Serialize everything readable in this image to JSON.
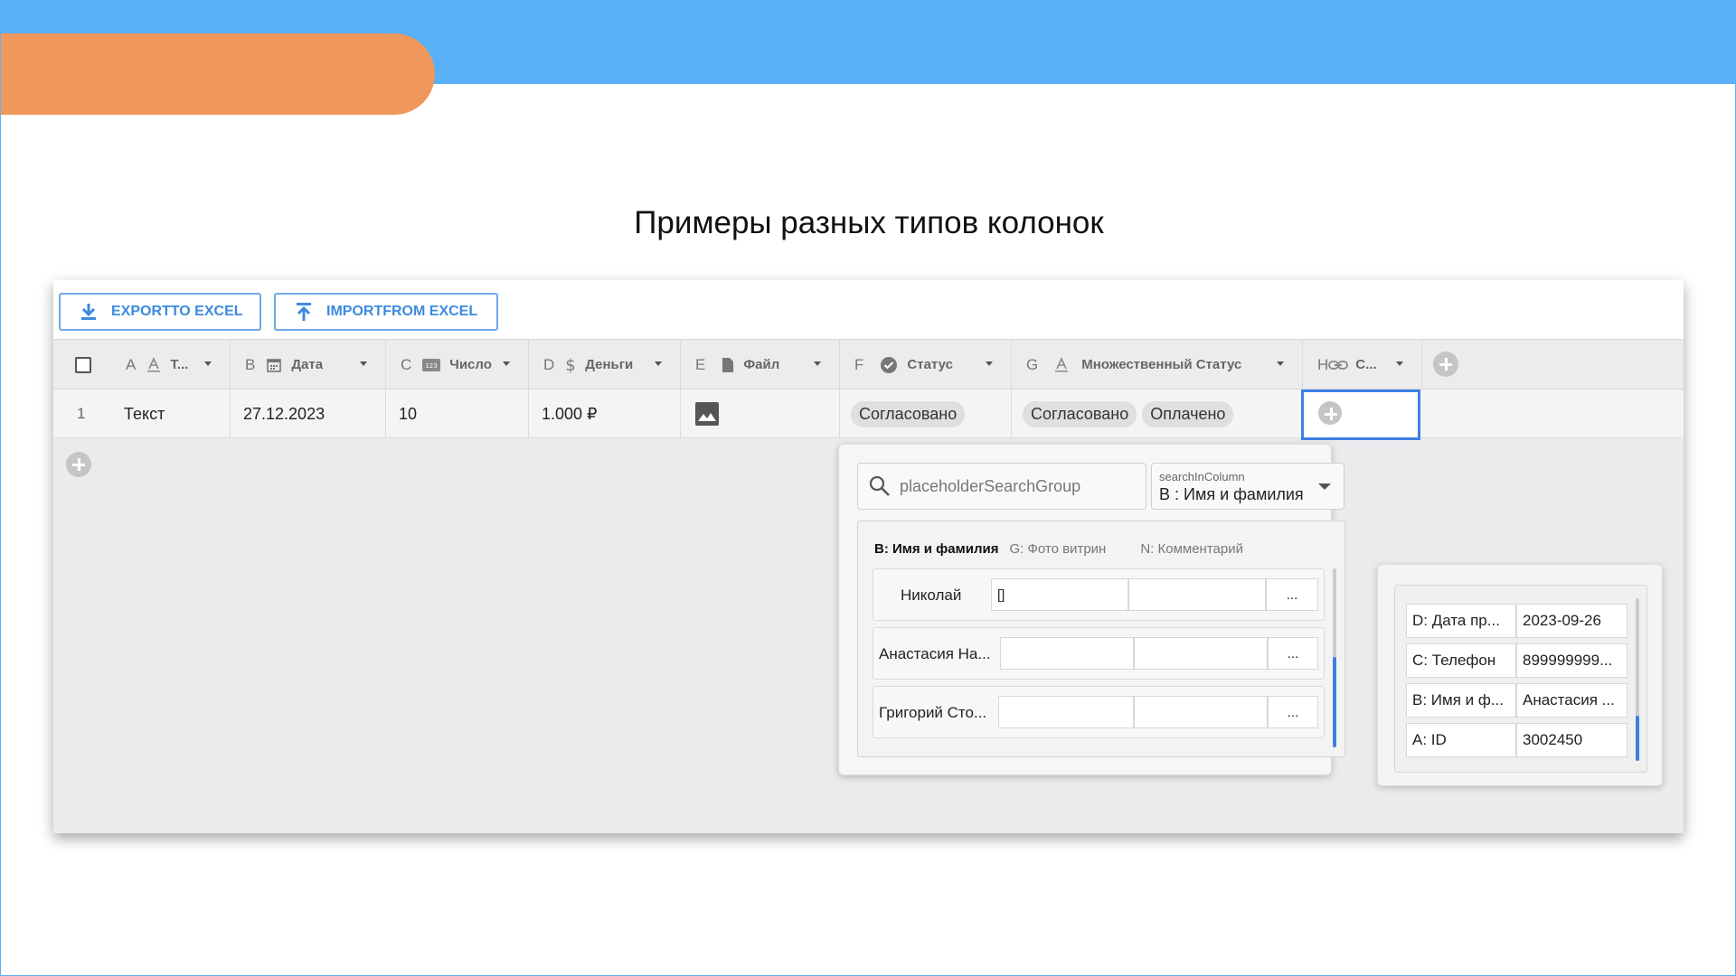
{
  "slide": {
    "title": "Примеры разных типов колонок"
  },
  "toolbar": {
    "export_label": "EXPORTTO EXCEL",
    "import_label": "IMPORTFROM EXCEL"
  },
  "columns": [
    {
      "letter": "A",
      "icon": "text-icon",
      "name": "Т..."
    },
    {
      "letter": "B",
      "icon": "calendar-icon",
      "name": "Дата"
    },
    {
      "letter": "C",
      "icon": "number-123-icon",
      "name": "Число"
    },
    {
      "letter": "D",
      "icon": "dollar-icon",
      "name": "Деньги"
    },
    {
      "letter": "E",
      "icon": "file-icon",
      "name": "Файл"
    },
    {
      "letter": "F",
      "icon": "check-circle-icon",
      "name": "Статус"
    },
    {
      "letter": "G",
      "icon": "text-icon",
      "name": "Множественный Статус"
    },
    {
      "letter": "H",
      "icon": "link-icon",
      "name": "С..."
    }
  ],
  "row": {
    "number": "1",
    "text": "Текст",
    "date": "27.12.2023",
    "number_value": "10",
    "money": "1.000 ₽",
    "file_icon": "image-icon",
    "status": "Согласовано",
    "multi_status": [
      "Согласовано",
      "Оплачено"
    ]
  },
  "link_popup": {
    "search_placeholder": "placeholderSearchGroup",
    "select_label": "searchInColumn",
    "select_value": "B : Имя и фамилия",
    "tabs": [
      "B: Имя и фамилия",
      "G: Фото витрин",
      "N: Комментарий"
    ],
    "items": [
      {
        "name": "Николай",
        "field1": "[]",
        "field2": "",
        "more": "..."
      },
      {
        "name": "Анастасия На...",
        "field1": "",
        "field2": "",
        "more": "..."
      },
      {
        "name": "Григорий Сто...",
        "field1": "",
        "field2": "",
        "more": "..."
      }
    ]
  },
  "detail_card": {
    "rows": [
      {
        "label": "D: Дата пр...",
        "value": "2023-09-26"
      },
      {
        "label": "C: Телефон",
        "value": "899999999..."
      },
      {
        "label": "B: Имя и ф...",
        "value": "Анастасия ..."
      },
      {
        "label": "A: ID",
        "value": "3002450"
      }
    ]
  },
  "colors": {
    "banner_blue": "#5ab0f7",
    "banner_orange": "#f0985b",
    "accent": "#3d80e6"
  }
}
